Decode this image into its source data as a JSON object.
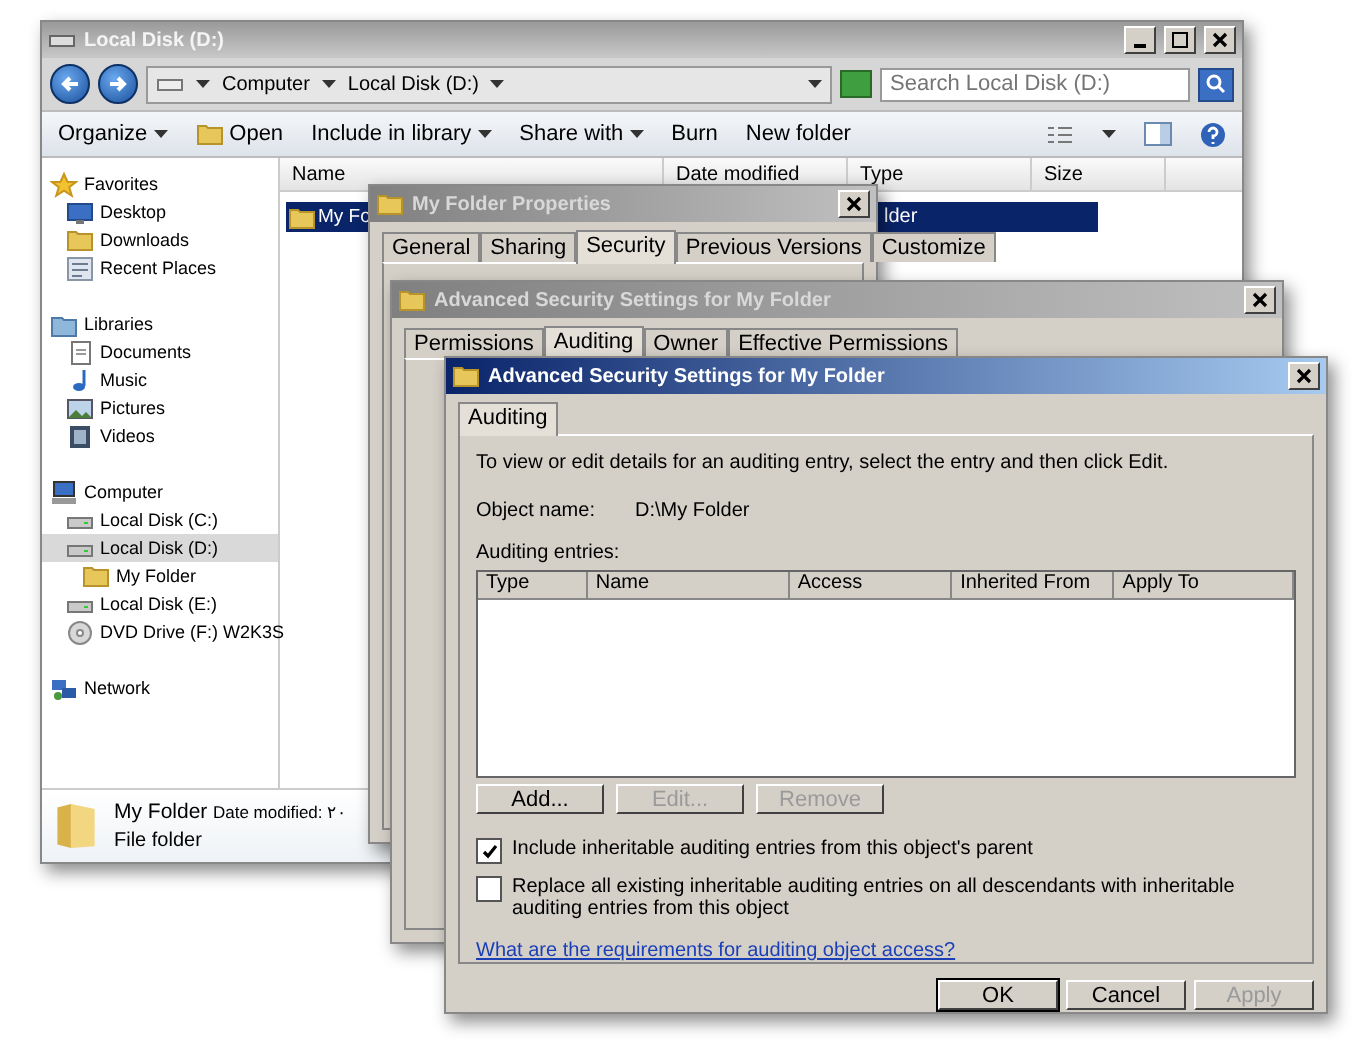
{
  "explorer": {
    "title": "Local Disk (D:)",
    "crumbs": [
      "Computer",
      "Local Disk (D:)"
    ],
    "search": {
      "placeholder": "Search Local Disk (D:)"
    },
    "toolbar": [
      {
        "label": "Organize",
        "kind": "menu"
      },
      {
        "label": "Open",
        "kind": "icon"
      },
      {
        "label": "Include in library",
        "kind": "menu"
      },
      {
        "label": "Share with",
        "kind": "menu"
      },
      {
        "label": "Burn",
        "kind": "plain"
      },
      {
        "label": "New folder",
        "kind": "plain"
      }
    ],
    "nav": [
      {
        "label": "Favorites",
        "kind": "star",
        "selected": false,
        "children": [
          {
            "label": "Desktop",
            "kind": "desktop",
            "selected": false
          },
          {
            "label": "Downloads",
            "kind": "folder",
            "selected": false
          },
          {
            "label": "Recent Places",
            "kind": "recent",
            "selected": false
          }
        ]
      },
      {
        "label": "Libraries",
        "kind": "library",
        "selected": false,
        "children": [
          {
            "label": "Documents",
            "kind": "document",
            "selected": false
          },
          {
            "label": "Music",
            "kind": "music",
            "selected": false
          },
          {
            "label": "Pictures",
            "kind": "picture",
            "selected": false
          },
          {
            "label": "Videos",
            "kind": "video",
            "selected": false
          }
        ]
      },
      {
        "label": "Computer",
        "kind": "computer",
        "selected": false,
        "children": [
          {
            "label": "Local Disk (C:)",
            "kind": "drive",
            "selected": false
          },
          {
            "label": "Local Disk (D:)",
            "kind": "drive",
            "selected": true,
            "children": [
              {
                "label": "My Folder",
                "kind": "folder",
                "selected": false
              }
            ]
          },
          {
            "label": "Local Disk (E:)",
            "kind": "drive",
            "selected": false
          },
          {
            "label": "DVD Drive (F:) W2K3S",
            "kind": "dvd",
            "selected": false
          }
        ]
      },
      {
        "label": "Network",
        "kind": "network",
        "selected": false
      }
    ],
    "columns": [
      "Name",
      "Date modified",
      "Type",
      "Size"
    ],
    "rows": [
      {
        "name": "My Fo",
        "type": "lder",
        "selected": true
      }
    ],
    "details": {
      "name": "My Folder",
      "date": "Date modified: ۲۰",
      "kind": "File folder"
    }
  },
  "properties": {
    "title": "My Folder Properties",
    "tabs": [
      {
        "label": "General",
        "selected": false
      },
      {
        "label": "Sharing",
        "selected": false
      },
      {
        "label": "Security",
        "selected": true
      },
      {
        "label": "Previous Versions",
        "selected": false
      },
      {
        "label": "Customize",
        "selected": false
      }
    ]
  },
  "advanced_back": {
    "title": "Advanced Security Settings for My Folder",
    "tabs": [
      {
        "label": "Permissions",
        "selected": false
      },
      {
        "label": "Auditing",
        "selected": true
      },
      {
        "label": "Owner",
        "selected": false
      },
      {
        "label": "Effective Permissions",
        "selected": false
      }
    ]
  },
  "advanced": {
    "title": "Advanced Security Settings for My Folder",
    "tabs": [
      {
        "label": "Auditing",
        "selected": true
      }
    ],
    "intro": "To view or edit details for an auditing entry, select the entry and then click Edit.",
    "object_label": "Object name:",
    "object_value": "D:\\My Folder",
    "entries_label": "Auditing entries:",
    "columns": [
      "Type",
      "Name",
      "Access",
      "Inherited From",
      "Apply To"
    ],
    "buttons": [
      {
        "label": "Add...",
        "disabled": false
      },
      {
        "label": "Edit...",
        "disabled": true
      },
      {
        "label": "Remove",
        "disabled": true
      }
    ],
    "options": [
      {
        "label": "Include inheritable auditing entries from this object's parent",
        "checked": true
      },
      {
        "label": "Replace all existing inheritable auditing entries on all descendants with inheritable auditing entries from this object",
        "checked": false
      }
    ],
    "link": "What are the requirements for auditing object access?",
    "footer": [
      {
        "label": "OK",
        "disabled": false
      },
      {
        "label": "Cancel",
        "disabled": false
      },
      {
        "label": "Apply",
        "disabled": true
      }
    ]
  }
}
